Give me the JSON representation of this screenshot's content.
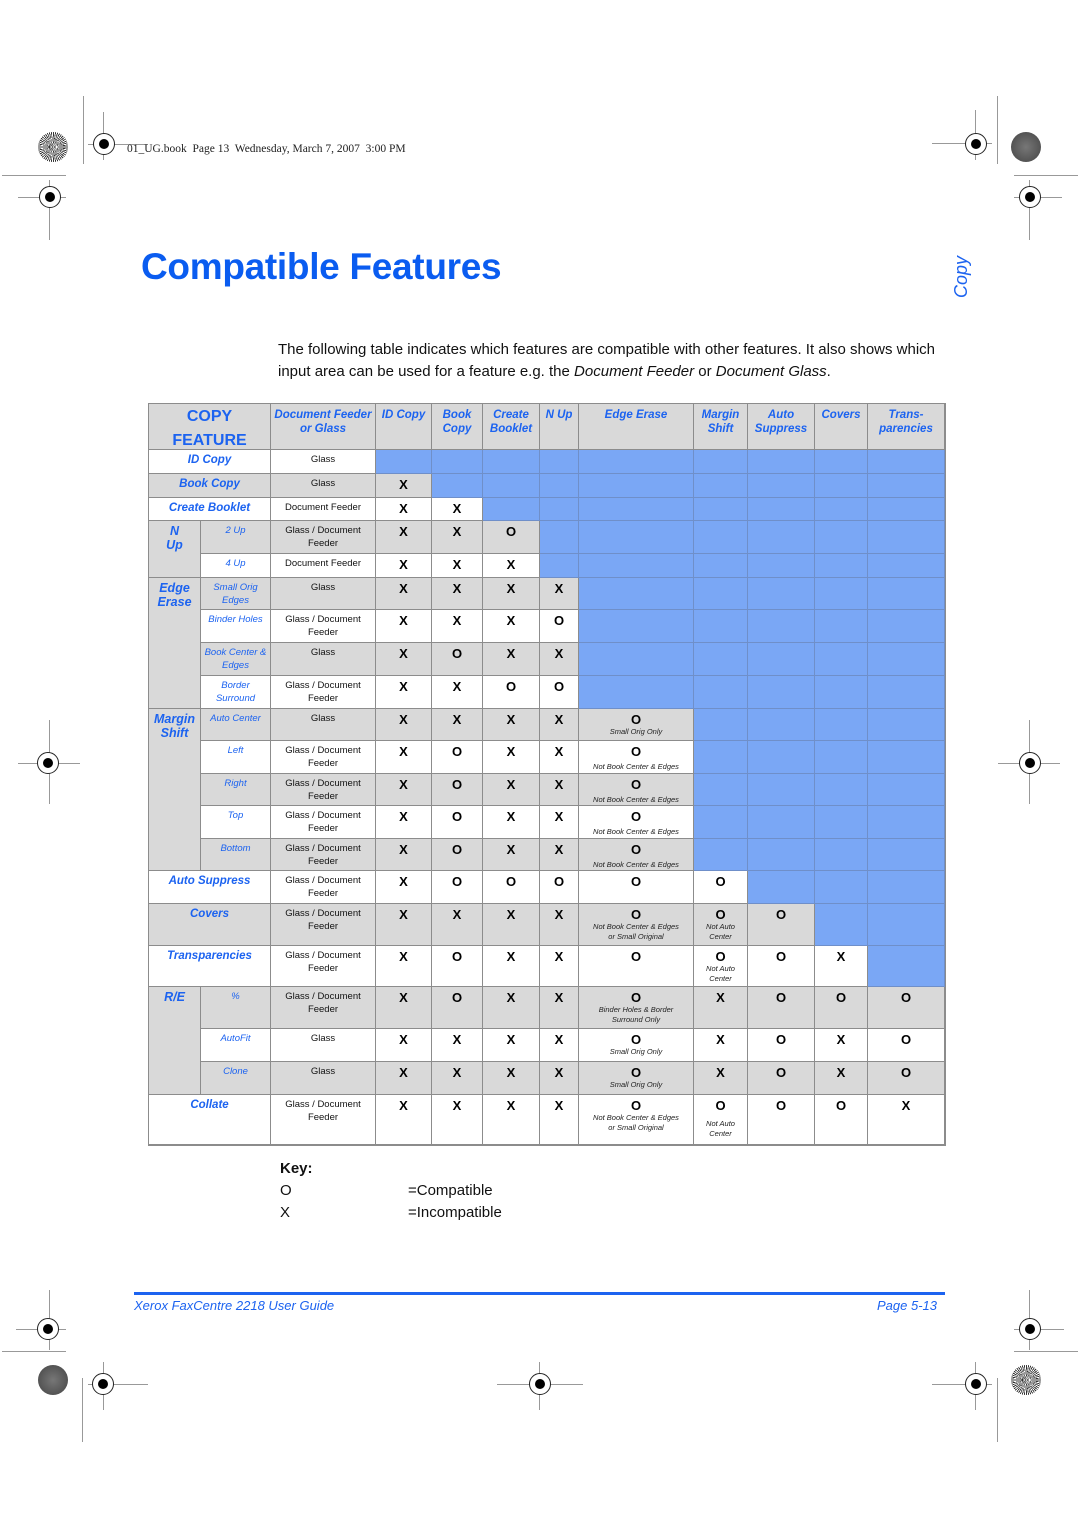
{
  "print_marker": "01_UG.book  Page 13  Wednesday, March 7, 2007  3:00 PM",
  "page": {
    "title": "Compatible Features",
    "side_tab": "Copy",
    "intro_part1": "The following table indicates which features are compatible with other features. It also shows which input area can be used for a feature e.g. the ",
    "intro_em1": "Document Feeder",
    "intro_mid": " or ",
    "intro_em2": "Document Glass",
    "intro_end": "."
  },
  "table": {
    "corner": [
      "COPY",
      "FEATURE"
    ],
    "source_header": "Document Feeder or Glass",
    "columns": [
      "ID Copy",
      "Book Copy",
      "Create Booklet",
      "N Up",
      "Edge Erase",
      "Margin Shift",
      "Auto Suppress",
      "Covers",
      "Trans-parencies"
    ],
    "groups": [
      {
        "label": "N Up",
        "rows": [
          3,
          4
        ]
      },
      {
        "label": "Edge Erase",
        "rows": [
          5,
          6,
          7,
          8
        ]
      },
      {
        "label": "Margin Shift",
        "rows": [
          9,
          10,
          11,
          12,
          13
        ]
      },
      {
        "label": "R/E",
        "rows": [
          17,
          18,
          19
        ]
      }
    ],
    "rows": [
      {
        "feature": "ID Copy",
        "sub": "",
        "source": "Glass",
        "shade": "white",
        "values": []
      },
      {
        "feature": "Book Copy",
        "sub": "",
        "source": "Glass",
        "shade": "gray",
        "values": [
          {
            "v": "X"
          }
        ]
      },
      {
        "feature": "Create Booklet",
        "sub": "",
        "source": "Document Feeder",
        "shade": "white",
        "values": [
          {
            "v": "X"
          },
          {
            "v": "X"
          }
        ]
      },
      {
        "feature": "N Up",
        "sub": "2 Up",
        "source": "Glass / Document Feeder",
        "shade": "gray",
        "values": [
          {
            "v": "X"
          },
          {
            "v": "X"
          },
          {
            "v": "O"
          }
        ]
      },
      {
        "feature": "N Up",
        "sub": "4 Up",
        "source": "Document Feeder",
        "shade": "white",
        "values": [
          {
            "v": "X"
          },
          {
            "v": "X"
          },
          {
            "v": "X"
          }
        ]
      },
      {
        "feature": "Edge Erase",
        "sub": "Small Orig Edges",
        "source": "Glass",
        "shade": "gray",
        "values": [
          {
            "v": "X"
          },
          {
            "v": "X"
          },
          {
            "v": "X"
          },
          {
            "v": "X"
          }
        ]
      },
      {
        "feature": "Edge Erase",
        "sub": "Binder Holes",
        "source": "Glass / Document Feeder",
        "shade": "white",
        "values": [
          {
            "v": "X"
          },
          {
            "v": "X"
          },
          {
            "v": "X"
          },
          {
            "v": "O"
          }
        ]
      },
      {
        "feature": "Edge Erase",
        "sub": "Book Center & Edges",
        "source": "Glass",
        "shade": "gray",
        "values": [
          {
            "v": "X"
          },
          {
            "v": "O"
          },
          {
            "v": "X"
          },
          {
            "v": "X"
          }
        ]
      },
      {
        "feature": "Edge Erase",
        "sub": "Border Surround",
        "source": "Glass / Document Feeder",
        "shade": "white",
        "values": [
          {
            "v": "X"
          },
          {
            "v": "X"
          },
          {
            "v": "O"
          },
          {
            "v": "O"
          }
        ]
      },
      {
        "feature": "Margin Shift",
        "sub": "Auto Center",
        "source": "Glass",
        "shade": "gray",
        "values": [
          {
            "v": "X"
          },
          {
            "v": "X"
          },
          {
            "v": "X"
          },
          {
            "v": "X"
          },
          {
            "v": "O",
            "note": "Small Orig Only"
          }
        ]
      },
      {
        "feature": "Margin Shift",
        "sub": "Left",
        "source": "Glass / Document Feeder",
        "shade": "white",
        "values": [
          {
            "v": "X"
          },
          {
            "v": "O"
          },
          {
            "v": "X"
          },
          {
            "v": "X"
          },
          {
            "v": "O",
            "note": "Not Book Center & Edges"
          }
        ]
      },
      {
        "feature": "Margin Shift",
        "sub": "Right",
        "source": "Glass / Document Feeder",
        "shade": "gray",
        "values": [
          {
            "v": "X"
          },
          {
            "v": "O"
          },
          {
            "v": "X"
          },
          {
            "v": "X"
          },
          {
            "v": "O",
            "note": "Not Book Center & Edges"
          }
        ]
      },
      {
        "feature": "Margin Shift",
        "sub": "Top",
        "source": "Glass / Document Feeder",
        "shade": "white",
        "values": [
          {
            "v": "X"
          },
          {
            "v": "O"
          },
          {
            "v": "X"
          },
          {
            "v": "X"
          },
          {
            "v": "O",
            "note": "Not Book Center & Edges"
          }
        ]
      },
      {
        "feature": "Margin Shift",
        "sub": "Bottom",
        "source": "Glass / Document Feeder",
        "shade": "gray",
        "values": [
          {
            "v": "X"
          },
          {
            "v": "O"
          },
          {
            "v": "X"
          },
          {
            "v": "X"
          },
          {
            "v": "O",
            "note": "Not Book Center & Edges"
          }
        ]
      },
      {
        "feature": "Auto Suppress",
        "sub": "",
        "source": "Glass / Document Feeder",
        "shade": "white",
        "values": [
          {
            "v": "X"
          },
          {
            "v": "O"
          },
          {
            "v": "O"
          },
          {
            "v": "O"
          },
          {
            "v": "O"
          },
          {
            "v": "O"
          }
        ]
      },
      {
        "feature": "Covers",
        "sub": "",
        "source": "Glass / Document Feeder",
        "shade": "gray",
        "values": [
          {
            "v": "X"
          },
          {
            "v": "X"
          },
          {
            "v": "X"
          },
          {
            "v": "X"
          },
          {
            "v": "O",
            "note": "Not Book Center & Edges or Small Original"
          },
          {
            "v": "O",
            "note": "Not Auto Center"
          },
          {
            "v": "O"
          }
        ]
      },
      {
        "feature": "Transparencies",
        "sub": "",
        "source": "Glass / Document Feeder",
        "shade": "white",
        "values": [
          {
            "v": "X"
          },
          {
            "v": "O"
          },
          {
            "v": "X"
          },
          {
            "v": "X"
          },
          {
            "v": "O"
          },
          {
            "v": "O",
            "note": "Not Auto Center"
          },
          {
            "v": "O"
          },
          {
            "v": "X"
          }
        ]
      },
      {
        "feature": "R/E",
        "sub": "%",
        "source": "Glass / Document Feeder",
        "shade": "gray",
        "values": [
          {
            "v": "X"
          },
          {
            "v": "O"
          },
          {
            "v": "X"
          },
          {
            "v": "X"
          },
          {
            "v": "O",
            "note": "Binder Holes & Border Surround Only"
          },
          {
            "v": "X"
          },
          {
            "v": "O"
          },
          {
            "v": "O"
          },
          {
            "v": "O"
          }
        ]
      },
      {
        "feature": "R/E",
        "sub": "AutoFit",
        "source": "Glass",
        "shade": "white",
        "values": [
          {
            "v": "X"
          },
          {
            "v": "X"
          },
          {
            "v": "X"
          },
          {
            "v": "X"
          },
          {
            "v": "O",
            "note": "Small Orig Only"
          },
          {
            "v": "X"
          },
          {
            "v": "O"
          },
          {
            "v": "X"
          },
          {
            "v": "O"
          }
        ]
      },
      {
        "feature": "R/E",
        "sub": "Clone",
        "source": "Glass",
        "shade": "gray",
        "values": [
          {
            "v": "X"
          },
          {
            "v": "X"
          },
          {
            "v": "X"
          },
          {
            "v": "X"
          },
          {
            "v": "O",
            "note": "Small Orig Only"
          },
          {
            "v": "X"
          },
          {
            "v": "O"
          },
          {
            "v": "X"
          },
          {
            "v": "O"
          }
        ]
      },
      {
        "feature": "Collate",
        "sub": "",
        "source": "Glass / Document Feeder",
        "shade": "white",
        "values": [
          {
            "v": "X"
          },
          {
            "v": "X"
          },
          {
            "v": "X"
          },
          {
            "v": "X"
          },
          {
            "v": "O",
            "note": "Not Book Center & Edges or Small Original"
          },
          {
            "v": "O",
            "note": "Not Auto Center"
          },
          {
            "v": "O"
          },
          {
            "v": "O"
          },
          {
            "v": "X"
          }
        ]
      }
    ]
  },
  "key": {
    "title": "Key:",
    "items": [
      {
        "symbol": "O",
        "meaning": "=Compatible"
      },
      {
        "symbol": "X",
        "meaning": "=Incompatible"
      }
    ]
  },
  "footer": {
    "guide": "Xerox FaxCentre 2218 User Guide",
    "page": "Page 5-13"
  },
  "colors": {
    "accent_blue": "#1c63f0",
    "na_cell_blue": "#7aa7f5",
    "row_gray": "#d9d9d9"
  }
}
